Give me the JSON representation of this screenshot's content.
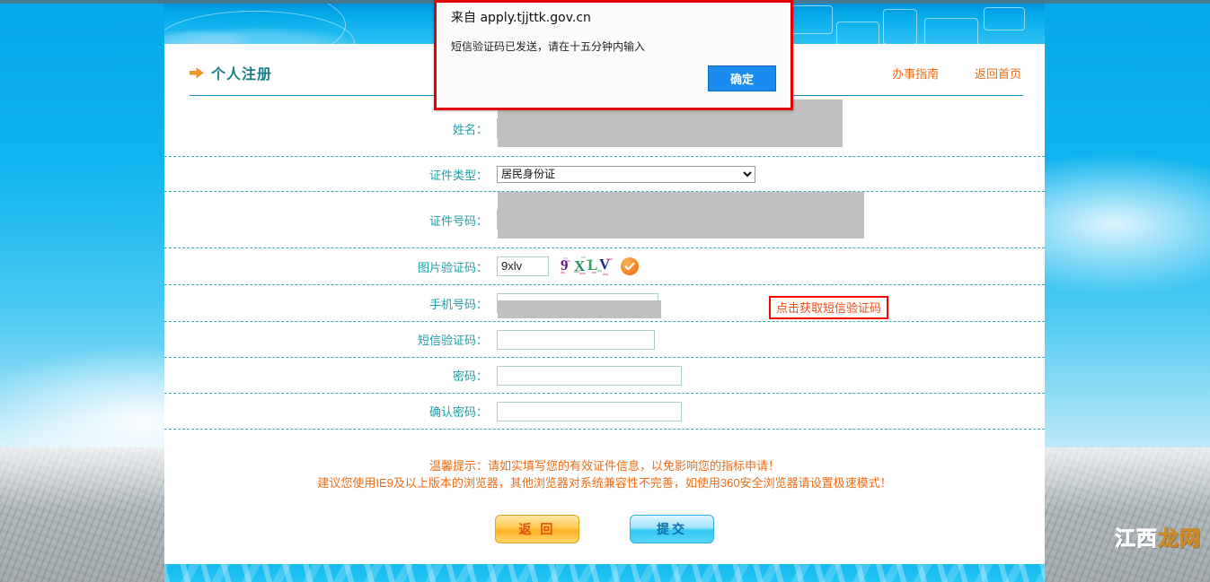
{
  "header": {
    "page_title": "个人注册",
    "arrow_icon": "arrow-right-icon",
    "nav": [
      {
        "label": "办事指南"
      },
      {
        "label": "返回首页"
      }
    ]
  },
  "dialog": {
    "origin": "来自 apply.tjjttk.gov.cn",
    "message": "短信验证码已发送，请在十五分钟内输入",
    "ok_label": "确定",
    "border_color": "#e60000",
    "button_color": "#1a8cf0"
  },
  "form": {
    "rows": [
      {
        "label": "姓名：",
        "value": "",
        "state": "redacted"
      },
      {
        "label": "证件类型：",
        "value": "居民身份证",
        "state": "select"
      },
      {
        "label": "证件号码：",
        "value": "",
        "state": "redacted"
      },
      {
        "label": "图片验证码：",
        "value": "9xlv",
        "state": "captcha"
      },
      {
        "label": "手机号码：",
        "value": "",
        "state": "redacted"
      },
      {
        "label": "短信验证码：",
        "value": "",
        "state": "empty"
      },
      {
        "label": "密码：",
        "value": "",
        "state": "empty"
      },
      {
        "label": "确认密码：",
        "value": "",
        "state": "empty"
      }
    ],
    "id_type_options": [
      "居民身份证"
    ],
    "captcha": {
      "input_value": "9xlv",
      "image_text": "9XLV",
      "chars": [
        {
          "ch": "9",
          "color": "#6a1a8a"
        },
        {
          "ch": "X",
          "color": "#1f8f5a"
        },
        {
          "ch": "L",
          "color": "#2f9e56"
        },
        {
          "ch": "V",
          "color": "#1a2f7a"
        }
      ],
      "verified_icon": "orange-check-icon"
    },
    "sms_button_label": "点击获取短信验证码",
    "sms_button_highlight_color": "#ff0000"
  },
  "notice": {
    "line1": "温馨提示：请如实填写您的有效证件信息，以免影响您的指标申请！",
    "line2": "建议您使用IE9及以上版本的浏览器，其他浏览器对系统兼容性不完善，如使用360安全浏览器请设置极速模式！",
    "color": "#ef6c15"
  },
  "buttons": {
    "back_label": "返 回",
    "submit_label": "提交"
  },
  "watermark": {
    "part1": "江西",
    "part2": "龙网"
  }
}
